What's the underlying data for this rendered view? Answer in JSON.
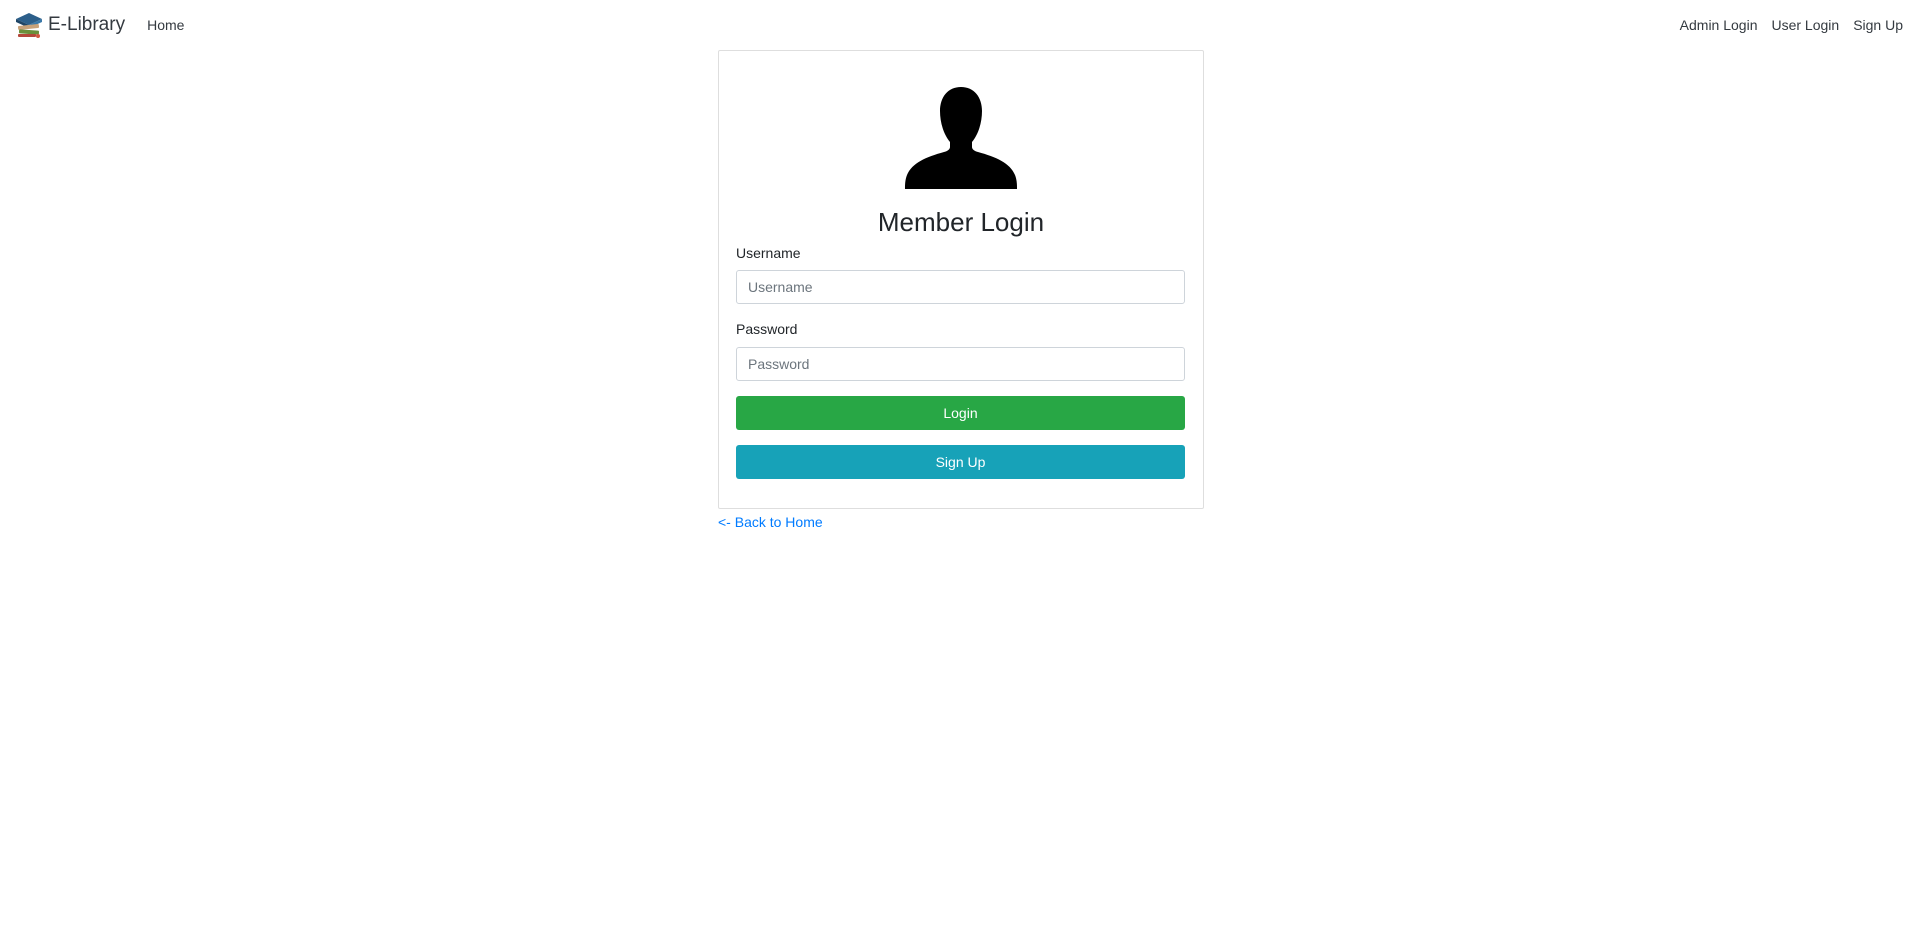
{
  "navbar": {
    "brand_text": "E-Library",
    "brand_icon": "book-stack-icon",
    "home_label": "Home",
    "right_links": {
      "admin_login": "Admin Login",
      "user_login": "User Login",
      "sign_up": "Sign Up"
    }
  },
  "login_card": {
    "avatar_icon": "user-silhouette-icon",
    "title": "Member Login",
    "username": {
      "label": "Username",
      "placeholder": "Username",
      "value": ""
    },
    "password": {
      "label": "Password",
      "placeholder": "Password",
      "value": ""
    },
    "login_button": "Login",
    "signup_button": "Sign Up"
  },
  "back_link": "<- Back to Home",
  "colors": {
    "login_button": "#28a745",
    "signup_button": "#17a2b8",
    "link": "#007bff",
    "nav_text": "#343a40"
  }
}
